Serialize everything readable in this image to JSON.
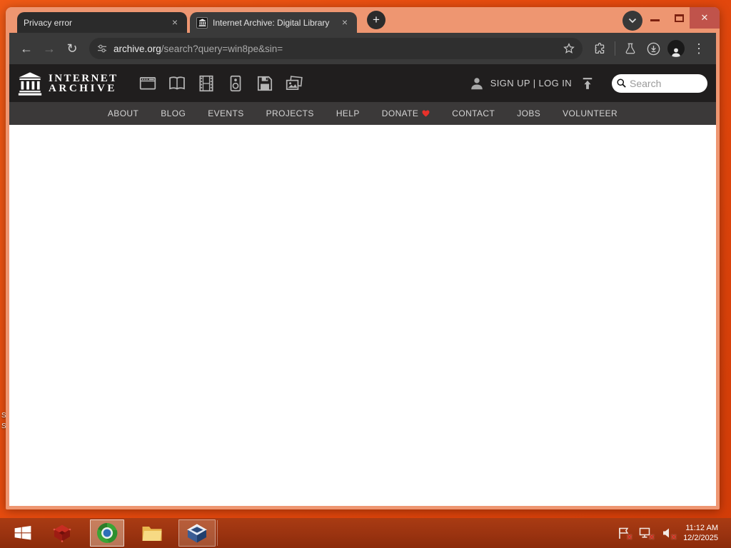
{
  "browser": {
    "tab1": {
      "title": "Privacy error"
    },
    "tab2": {
      "title": "Internet Archive: Digital Library"
    },
    "url_domain": "archive.org",
    "url_path": "/search?query=win8pe&sin="
  },
  "glyphs": {
    "tab_close": "×",
    "new_tab": "+",
    "window_close": "✕",
    "back": "←",
    "forward": "→",
    "reload": "↻",
    "menu_dots": "⋮"
  },
  "ia": {
    "wordmark_line1": "INTERNET",
    "wordmark_line2": "ARCHIVE",
    "auth_text": "SIGN UP | LOG IN",
    "search_placeholder": "Search",
    "nav": [
      "ABOUT",
      "BLOG",
      "EVENTS",
      "PROJECTS",
      "HELP",
      "DONATE",
      "CONTACT",
      "JOBS",
      "VOLUNTEER"
    ],
    "media_types": [
      "web",
      "texts",
      "video",
      "audio",
      "software",
      "images"
    ]
  },
  "taskbar": {
    "time": "11:12 AM",
    "date": "12/2/2025"
  },
  "desktop": {
    "fragment1": "S",
    "fragment2": "S"
  },
  "colors": {
    "desktop_orange": "#e64a0e",
    "frame_salmon": "#ee9671",
    "taskbar_red": "#9a3310",
    "toolbar_gray": "#3a3a3a",
    "ia_header_dark": "#201e1e",
    "ia_nav_gray": "#3b3939",
    "close_button_red": "#c0534b",
    "heart_red": "#e8312a"
  }
}
